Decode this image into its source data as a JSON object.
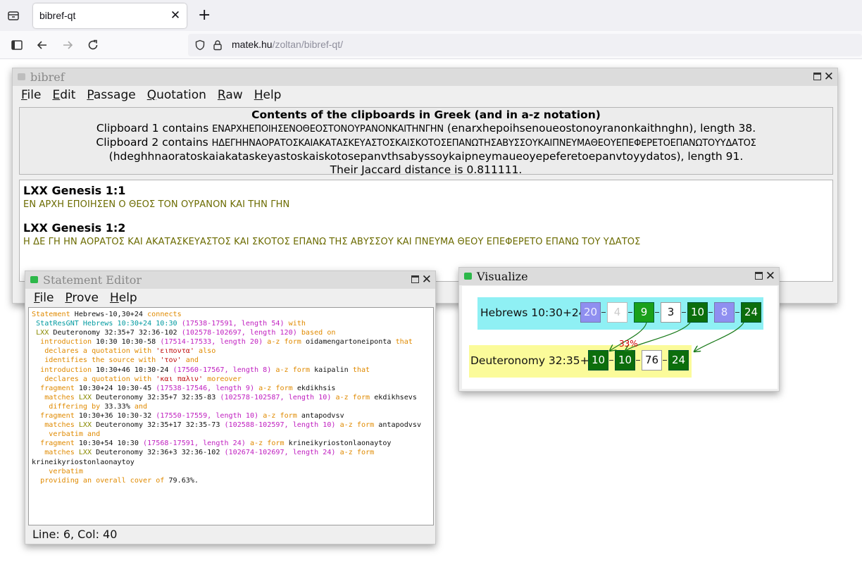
{
  "browser": {
    "tab_title": "bibref-qt",
    "url_host": "matek.hu",
    "url_path": "/zoltan/bibref-qt/"
  },
  "bibref": {
    "title": "bibref",
    "menu": [
      "File",
      "Edit",
      "Passage",
      "Quotation",
      "Raw",
      "Help"
    ],
    "clip_header": "Contents of the clipboards in Greek (and in a-z notation)",
    "clip1_prefix": "Clipboard 1 contains ",
    "clip1_greek": "ΕΝΑΡΧΗΕΠΟΙΗΣΕΝΟΘΕΟΣΤΟΝΟΥΡΑΝΟΝΚΑΙΤΗΝΓΗΝ",
    "clip1_suffix": " (enarxhepoihsenoueostonoyranonkaithnghn), length 38.",
    "clip2_prefix": "Clipboard 2 contains ",
    "clip2_greek": "ΗΔΕΓΗΗΝΑΟΡΑΤΟΣΚΑΙΑΚΑΤΑΣΚΕΥΑΣΤΟΣΚΑΙΣΚΟΤΟΣΕΠΑΝΩΤΗΣΑΒΥΣΣΟΥΚΑΙΠΝΕΥΜΑΘΕΟΥΕΠΕΦΕΡΕΤΟΕΠΑΝΩΤΟΥΥΔΑΤΟΣ",
    "clip2_latin": "(hdeghhnaoratoskaiakataskeyastoskaiskotosepanvthsabyssoykaipneymaueoyepeferetoepanvtoyydatos), length 91.",
    "jaccard": "Their Jaccard distance is 0.811111.",
    "passages": [
      {
        "ref": "LXX Genesis 1:1",
        "text": "ΕΝ ΑΡΧΗ ΕΠΟΙΗΣΕΝ Ο ΘΕΟΣ ΤΟΝ ΟΥΡΑΝΟΝ ΚΑΙ ΤΗΝ ΓΗΝ"
      },
      {
        "ref": "LXX Genesis 1:2",
        "text": "Η ΔΕ ΓΗ ΗΝ ΑΟΡΑΤΟΣ ΚΑΙ ΑΚΑΤΑΣΚΕΥΑΣΤΟΣ ΚΑΙ ΣΚΟΤΟΣ ΕΠΑΝΩ ΤΗΣ ΑΒΥΣΣΟΥ ΚΑΙ ΠΝΕΥΜΑ ΘΕΟΥ ΕΠΕΦΕΡΕΤΟ ΕΠΑΝΩ ΤΟΥ ΥΔΑΤΟΣ"
      }
    ]
  },
  "editor": {
    "title": "Statement Editor",
    "menu": [
      "File",
      "Prove",
      "Help"
    ],
    "status": "Line: 6, Col: 40",
    "lines": [
      [
        [
          "or",
          "Statement "
        ],
        [
          "bk",
          "Hebrews-10,30+24 "
        ],
        [
          "or",
          "connects"
        ]
      ],
      [
        [
          "te",
          " StatResGNT Hebrews 10:30+24 10:30 "
        ],
        [
          "pk",
          "(17538-17591, length 54) "
        ],
        [
          "or",
          "with"
        ]
      ],
      [
        [
          "ol",
          " LXX "
        ],
        [
          "bk",
          "Deuteronomy 32:35+7 32:36-102 "
        ],
        [
          "pk",
          "(102578-102697, length 120) "
        ],
        [
          "or",
          "based on"
        ]
      ],
      [
        [
          "or",
          "  introduction "
        ],
        [
          "bk",
          "10:30 10:30-58 "
        ],
        [
          "pk",
          "(17514-17533, length 20) "
        ],
        [
          "or",
          "a-z form "
        ],
        [
          "bk",
          "oidamengartoneiponta "
        ],
        [
          "or",
          "that"
        ]
      ],
      [
        [
          "or",
          "   declares a quotation with "
        ],
        [
          "rd",
          "'ειποντα'"
        ],
        [
          "or",
          " also"
        ]
      ],
      [
        [
          "or",
          "   identifies the source with "
        ],
        [
          "rd",
          "'τον'"
        ],
        [
          "or",
          " and"
        ]
      ],
      [
        [
          "or",
          "  introduction "
        ],
        [
          "bk",
          "10:30+46 10:30-24 "
        ],
        [
          "pk",
          "(17560-17567, length 8) "
        ],
        [
          "or",
          "a-z form "
        ],
        [
          "bk",
          "kaipalin "
        ],
        [
          "or",
          "that"
        ]
      ],
      [
        [
          "or",
          "   declares a quotation with "
        ],
        [
          "rd",
          "'και παλιν'"
        ],
        [
          "or",
          " moreover"
        ]
      ],
      [
        [
          "or",
          "  fragment "
        ],
        [
          "bk",
          "10:30+24 10:30-45 "
        ],
        [
          "pk",
          "(17538-17546, length 9) "
        ],
        [
          "or",
          "a-z form "
        ],
        [
          "bk",
          "ekdikhsis"
        ]
      ],
      [
        [
          "or",
          "   matches "
        ],
        [
          "ol",
          "LXX "
        ],
        [
          "bk",
          "Deuteronomy 32:35+7 32:35-83 "
        ],
        [
          "pk",
          "(102578-102587, length 10) "
        ],
        [
          "or",
          "a-z form "
        ],
        [
          "bk",
          "ekdikhsevs"
        ]
      ],
      [
        [
          "or",
          "    differing by "
        ],
        [
          "bk",
          "33.33% "
        ],
        [
          "or",
          "and"
        ]
      ],
      [
        [
          "or",
          "  fragment "
        ],
        [
          "bk",
          "10:30+36 10:30-32 "
        ],
        [
          "pk",
          "(17550-17559, length 10) "
        ],
        [
          "or",
          "a-z form "
        ],
        [
          "bk",
          "antapodvsv"
        ]
      ],
      [
        [
          "or",
          "   matches "
        ],
        [
          "ol",
          "LXX "
        ],
        [
          "bk",
          "Deuteronomy 32:35+17 32:35-73 "
        ],
        [
          "pk",
          "(102588-102597, length 10) "
        ],
        [
          "or",
          "a-z form "
        ],
        [
          "bk",
          "antapodvsv"
        ]
      ],
      [
        [
          "or",
          "    verbatim and"
        ]
      ],
      [
        [
          "or",
          "  fragment "
        ],
        [
          "bk",
          "10:30+54 10:30 "
        ],
        [
          "pk",
          "(17568-17591, length 24) "
        ],
        [
          "or",
          "a-z form "
        ],
        [
          "bk",
          "krineikyriostonlaonaytoy"
        ]
      ],
      [
        [
          "or",
          "   matches "
        ],
        [
          "ol",
          "LXX "
        ],
        [
          "bk",
          "Deuteronomy 32:36+3 32:36-102 "
        ],
        [
          "pk",
          "(102674-102697, length 24) "
        ],
        [
          "or",
          "a-z form"
        ]
      ],
      [
        [
          "bk",
          "krineikyriostonlaonaytoy"
        ]
      ],
      [
        [
          "or",
          "    verbatim"
        ]
      ],
      [
        [
          "or",
          "  providing an overall cover of "
        ],
        [
          "bk",
          "79.63%."
        ]
      ]
    ]
  },
  "visual": {
    "title": "Visualize",
    "top_label": "Hebrews 10:30+24",
    "top_boxes": [
      {
        "v": "20",
        "style": "lav"
      },
      {
        "v": "4",
        "style": "wf"
      },
      {
        "v": "9",
        "style": "mg"
      },
      {
        "v": "3",
        "style": "wh"
      },
      {
        "v": "10",
        "style": "dg"
      },
      {
        "v": "8",
        "style": "lav"
      },
      {
        "v": "24",
        "style": "dg"
      }
    ],
    "bottom_label": "Deuteronomy 32:35+7",
    "bottom_boxes": [
      {
        "v": "10",
        "style": "dg"
      },
      {
        "v": "10",
        "style": "dg"
      },
      {
        "v": "76",
        "style": "wh"
      },
      {
        "v": "24",
        "style": "dg"
      }
    ],
    "difference_label": "33%",
    "colors": {
      "top_band": "#8ff0f4",
      "bottom_band": "#fbfb9a",
      "arrow": "#1a7a1a",
      "difference": "#d00000"
    }
  }
}
